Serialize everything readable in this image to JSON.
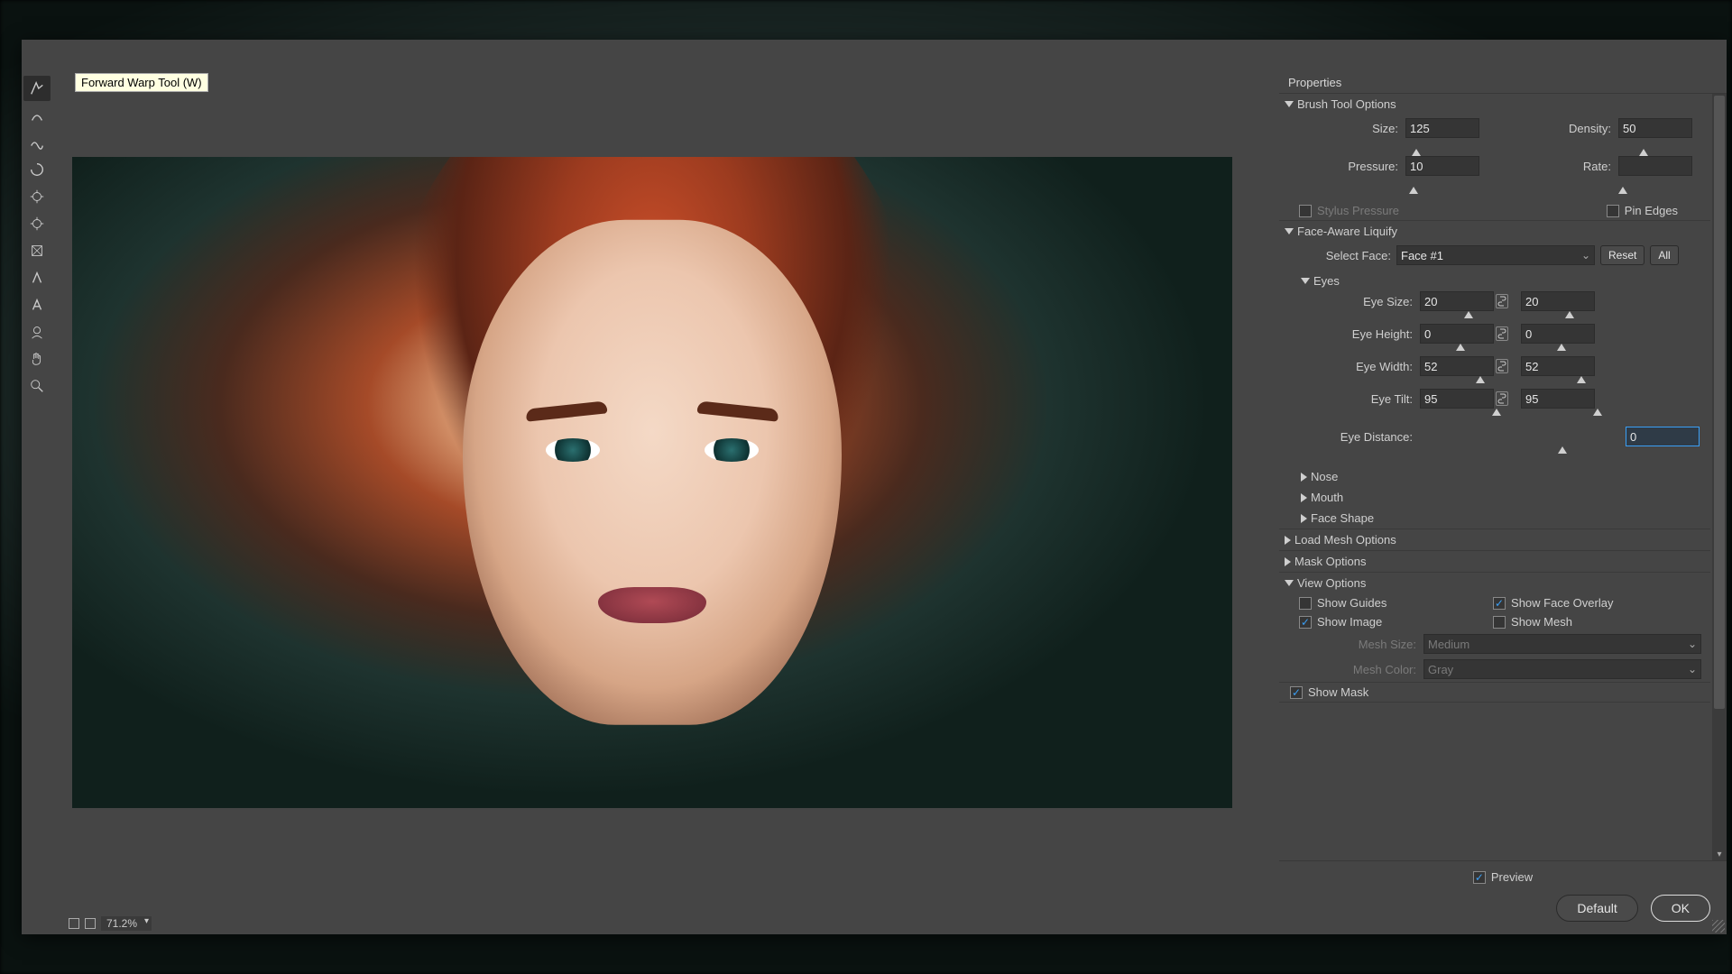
{
  "tooltip": "Forward Warp Tool (W)",
  "zoom": "71.2%",
  "panel_title": "Properties",
  "sections": {
    "brush": "Brush Tool Options",
    "face": "Face-Aware Liquify",
    "eyes": "Eyes",
    "nose": "Nose",
    "mouth": "Mouth",
    "faceshape": "Face Shape",
    "loadmesh": "Load Mesh Options",
    "mask": "Mask Options",
    "view": "View Options",
    "showmask": "Show Mask"
  },
  "brush": {
    "size_lbl": "Size:",
    "size": "125",
    "density_lbl": "Density:",
    "density": "50",
    "pressure_lbl": "Pressure:",
    "pressure": "10",
    "rate_lbl": "Rate:",
    "rate": "",
    "stylus": "Stylus Pressure",
    "pin": "Pin Edges"
  },
  "faceaware": {
    "select_lbl": "Select Face:",
    "select_val": "Face #1",
    "reset": "Reset",
    "all": "All"
  },
  "eyes": {
    "size_lbl": "Eye Size:",
    "size_l": "20",
    "size_r": "20",
    "height_lbl": "Eye Height:",
    "height_l": "0",
    "height_r": "0",
    "width_lbl": "Eye Width:",
    "width_l": "52",
    "width_r": "52",
    "tilt_lbl": "Eye Tilt:",
    "tilt_l": "95",
    "tilt_r": "95",
    "dist_lbl": "Eye Distance:",
    "dist": "0"
  },
  "view": {
    "guides": "Show Guides",
    "overlay": "Show Face Overlay",
    "image": "Show Image",
    "mesh": "Show Mesh",
    "meshsize_lbl": "Mesh Size:",
    "meshsize": "Medium",
    "meshcolor_lbl": "Mesh Color:",
    "meshcolor": "Gray"
  },
  "footer": {
    "preview": "Preview",
    "default": "Default",
    "ok": "OK"
  }
}
